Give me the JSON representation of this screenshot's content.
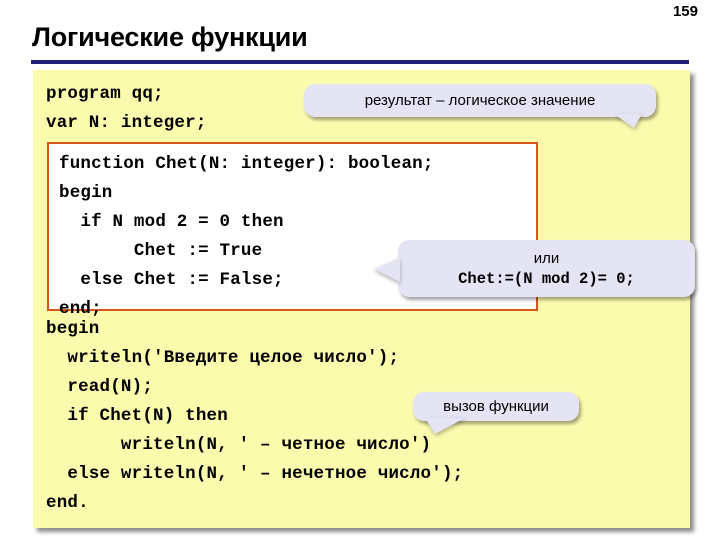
{
  "slide": {
    "page_number": "159",
    "title": "Логические функции",
    "rule_color": "#1f1f7a"
  },
  "code_panel": {
    "background_color": "#fbfbae",
    "header_code": "program qq;\nvar N: integer;",
    "function_box": {
      "border_color": "#d9541f",
      "background_color": "#ffffff",
      "code": "function Chet(N: integer): boolean;\nbegin\n  if N mod 2 = 0 then\n       Chet := True\n  else Chet := False;\nend;"
    },
    "body_code": "begin\n  writeln('Введите целое число');\n  read(N);\n  if Chet(N) then\n       writeln(N, ' – четное число')\n  else writeln(N, ' – нечетное число');\nend."
  },
  "callouts": {
    "bubble_color": "#e4e4f4",
    "result": {
      "text": "результат – логическое значение"
    },
    "alternative": {
      "label": "или",
      "code": "Chet:=(N mod 2)= 0;"
    },
    "call": {
      "text": "вызов функции"
    }
  }
}
